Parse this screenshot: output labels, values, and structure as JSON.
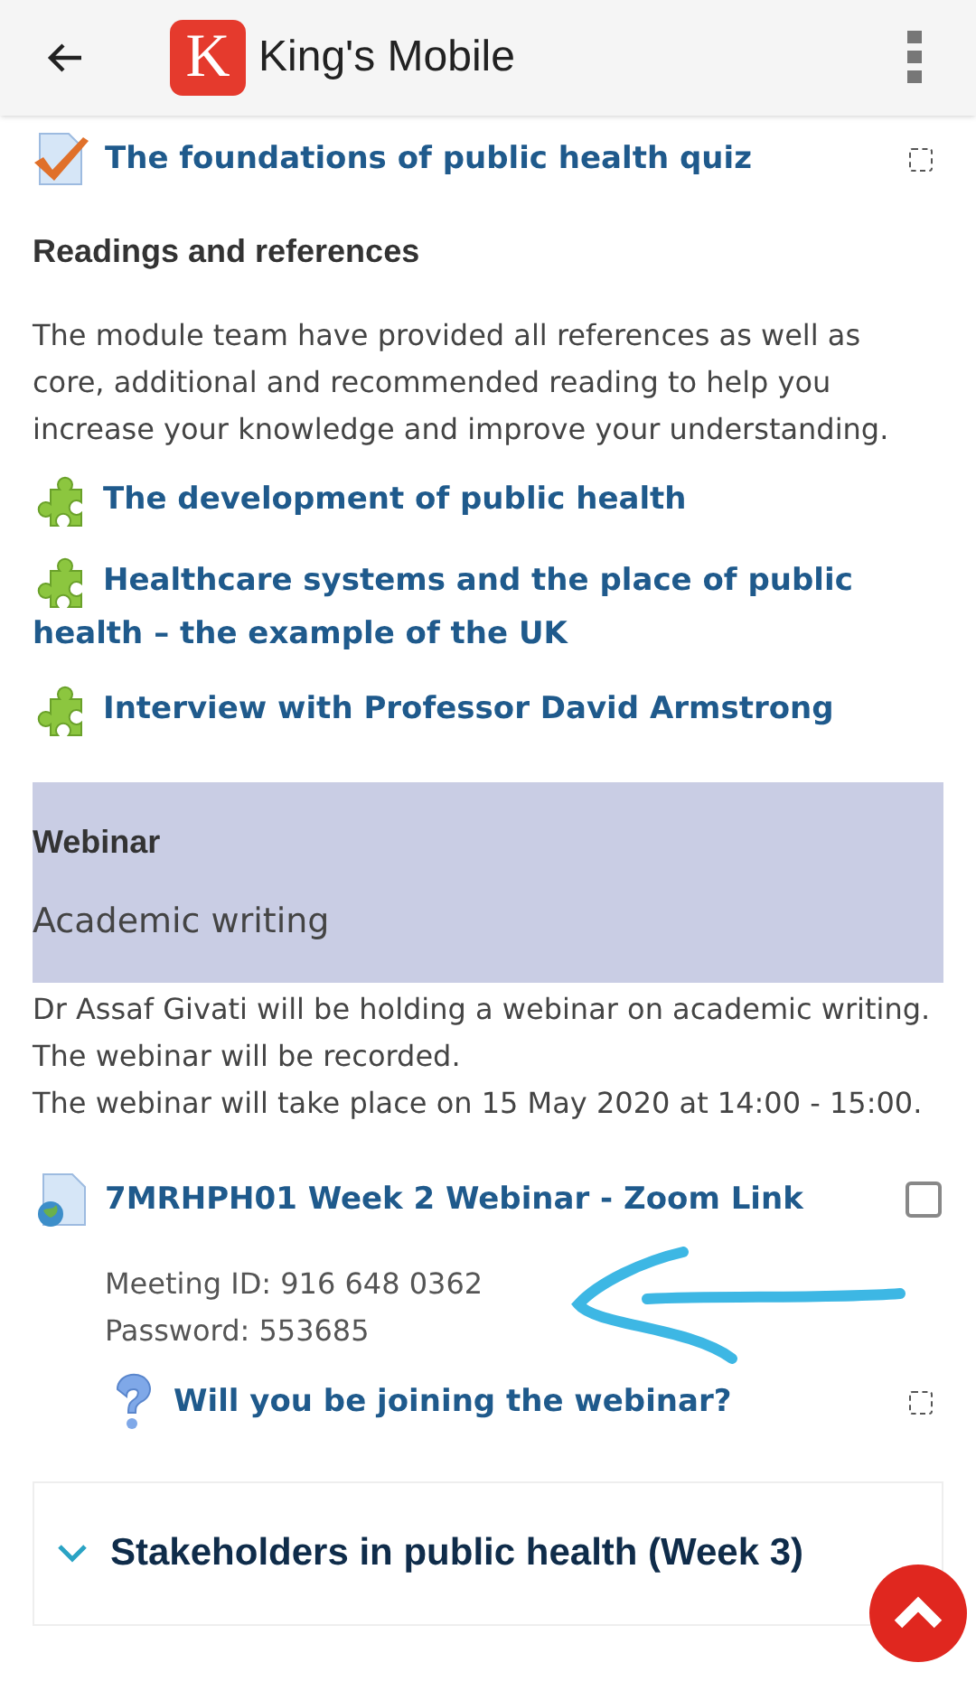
{
  "header": {
    "logo_letter": "K",
    "title": "King's Mobile"
  },
  "top_activity": {
    "kind": "quiz",
    "title": "The foundations of public health quiz",
    "completion": {
      "kind": "auto",
      "checked": false
    }
  },
  "readings": {
    "heading": "Readings and references",
    "text": "The module team have provided all references as well as core, additional and recommended reading to help you increase your knowledge and improve your understanding.",
    "items": [
      {
        "kind": "page",
        "title": "The development of public health"
      },
      {
        "kind": "page",
        "title": "Healthcare systems and the place of public health – the example of the UK"
      },
      {
        "kind": "page",
        "title": "Interview with Professor David Armstrong"
      }
    ]
  },
  "webinar": {
    "heading": "Webinar",
    "subheading": "Academic writing",
    "lines": [
      "Dr Assaf Givati will be holding a webinar on academic writing. The webinar will be recorded.",
      "The webinar will take place on 15 May 2020 at 14:00 - 15:00."
    ],
    "link": {
      "kind": "url",
      "title": "7MRHPH01 Week 2 Webinar - Zoom Link",
      "completion": {
        "kind": "manual",
        "checked": false
      },
      "details": [
        "Meeting ID: 916 648 0362",
        "Password: 553685"
      ]
    },
    "question": {
      "kind": "question",
      "title": "Will you be joining the webinar?",
      "completion": {
        "kind": "auto",
        "checked": false
      }
    }
  },
  "next_section": {
    "title": "Stakeholders in public health (Week 3)",
    "expanded": false
  }
}
